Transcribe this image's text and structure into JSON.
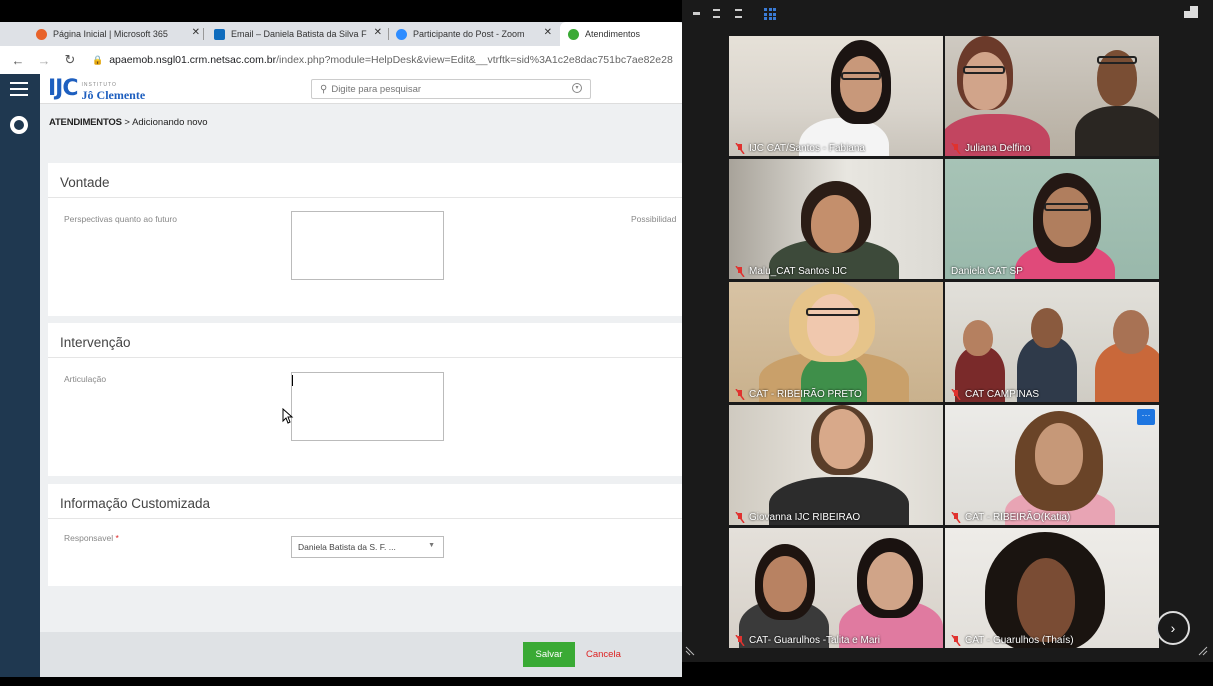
{
  "browser": {
    "tabs": [
      {
        "label": "Página Inicial | Microsoft 365",
        "icon": "office-icon",
        "color": "#e8632b"
      },
      {
        "label": "Email – Daniela Batista da Silva F",
        "icon": "outlook-icon",
        "color": "#0f6cbd"
      },
      {
        "label": "Participante do Post - Zoom",
        "icon": "zoom-icon",
        "color": "#2d8cff"
      },
      {
        "label": "Atendimentos",
        "icon": "crm-icon",
        "color": "#3aaa35"
      }
    ],
    "url_main": "apaemob.nsgl01.crm.netsac.com.br",
    "url_rest": "/index.php?module=HelpDesk&view=Edit&__vtrftk=sid%3A1c2e8dac751bc7ae82e28"
  },
  "crm": {
    "logo_small": "INSTITUTO",
    "logo_name": "Jô Clemente",
    "search_placeholder": "Digite para pesquisar",
    "breadcrumb_root": "ATENDIMENTOS",
    "breadcrumb_sep": ">",
    "breadcrumb_current": "Adicionando novo",
    "sections": {
      "vontade": {
        "title": "Vontade",
        "field_label": "Perspectivas quanto ao futuro",
        "field_label_2": "Possibilidad"
      },
      "intervencao": {
        "title": "Intervenção",
        "field_label": "Articulação"
      },
      "custom": {
        "title": "Informação Customizada",
        "field_label": "Responsavel",
        "required_mark": "*",
        "selected_value": "Daniela Batista da S. F. ..."
      }
    },
    "save_label": "Salvar",
    "cancel_label": "Cancela"
  },
  "zoom": {
    "participants": [
      {
        "name": "IJC CAT/Santos - Fabiana",
        "muted": true
      },
      {
        "name": "Juliana Delfino",
        "muted": true
      },
      {
        "name": "Malu_CAT Santos IJC",
        "muted": true
      },
      {
        "name": "Daniela CAT SP",
        "muted": false,
        "speaking": true
      },
      {
        "name": "CAT - RIBEIRÃO PRETO",
        "muted": true
      },
      {
        "name": "CAT CAMPINAS",
        "muted": true
      },
      {
        "name": "Giovanna IJC RIBEIRAO",
        "muted": true
      },
      {
        "name": "CAT - RIBEIRÃO(Katia)",
        "muted": true
      },
      {
        "name": "CAT- Guarulhos -Talita e Mari",
        "muted": true
      },
      {
        "name": "CAT - Guarulhos (Thaís)",
        "muted": true
      }
    ],
    "ellipsis_label": "···",
    "next_label": "›",
    "colors": {
      "accent": "#1d75e0",
      "speaking_border": "#e8e27a",
      "muted_mic": "#e0322f"
    }
  }
}
